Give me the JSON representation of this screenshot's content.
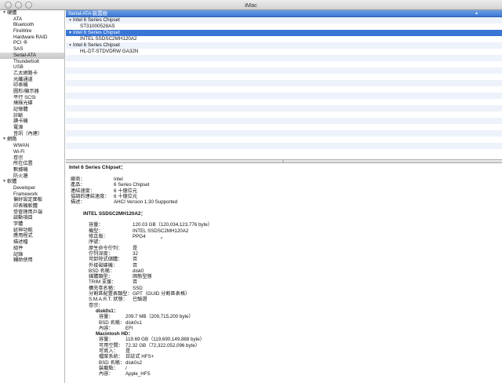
{
  "window": {
    "title": "iMac"
  },
  "sidebar": {
    "groups": [
      {
        "label": "硬體",
        "items": [
          "ATA",
          "Bluetooth",
          "FireWire",
          "Hardware RAID",
          "PCI 卡",
          "SAS",
          "Serial-ATA",
          "Thunderbolt",
          "USB",
          "乙太網路卡",
          "光纖通道",
          "印表機",
          "圖形/顯示器",
          "平行 SCSI",
          "燒錄光碟",
          "記憶體",
          "診斷",
          "讀卡機",
          "電源",
          "音訊（內建）"
        ]
      },
      {
        "label": "網路",
        "items": [
          "WWAN",
          "Wi-Fi",
          "卷宗",
          "所在位置",
          "數據機",
          "防火牆"
        ]
      },
      {
        "label": "軟體",
        "items": [
          "Developer",
          "Framework",
          "偏好設定面板",
          "印表機軟體",
          "受管理用戶端",
          "啟動項目",
          "字體",
          "延伸功能",
          "應用程式",
          "描述檔",
          "組件",
          "記錄",
          "輔助使用"
        ]
      }
    ],
    "selected": "Serial-ATA"
  },
  "tree": {
    "header": "Serial-ATA 裝置樹",
    "rows": [
      {
        "label": "Intel 6 Series Chipset",
        "level": 1,
        "expanded": true
      },
      {
        "label": "ST31000528AS",
        "level": 2
      },
      {
        "label": "Intel 6 Series Chipset",
        "level": 1,
        "expanded": true,
        "selected": true
      },
      {
        "label": "INTEL SSDSC2MH120A2",
        "level": 2
      },
      {
        "label": "Intel 6 Series Chipset",
        "level": 1,
        "expanded": true
      },
      {
        "label": "HL-DT-STDVDRW  GA32N",
        "level": 2
      }
    ]
  },
  "detail": {
    "title": "Intel 6 Series Chipset：",
    "controller": [
      {
        "k": "廠商：",
        "v": "Intel"
      },
      {
        "k": "產品：",
        "v": "6 Series Chipset"
      },
      {
        "k": "連結速度：",
        "v": "6 十億位元"
      },
      {
        "k": "協調的連結速度：",
        "v": "6 十億位元"
      },
      {
        "k": "描述：",
        "v": "AHCI Version 1.30 Supported"
      }
    ],
    "device_title": "INTEL SSDSC2MH120A2：",
    "device": [
      {
        "k": "容量：",
        "v": "120.03 GB（120,034,123,776 byte）"
      },
      {
        "k": "機型：",
        "v": "INTEL SSDSC2MH120A2"
      },
      {
        "k": "修正版：",
        "v": "PPG4"
      },
      {
        "k": "序號：",
        "v": ""
      },
      {
        "k": "原生命令佇列：",
        "v": "是"
      },
      {
        "k": "佇列深度：",
        "v": "32"
      },
      {
        "k": "可卸除式儲體：",
        "v": "否"
      },
      {
        "k": "外接磁碟機：",
        "v": "否"
      },
      {
        "k": "BSD 名稱：",
        "v": "disk0"
      },
      {
        "k": "媒體類型：",
        "v": "固態型態"
      },
      {
        "k": "TRIM 支援：",
        "v": "否"
      },
      {
        "k": "擴充卷名稱：",
        "v": "SSD"
      },
      {
        "k": "分割區配置表類型：",
        "v": "GPT（GUID 分割區表格）"
      },
      {
        "k": "S.M.A.R.T. 狀態：",
        "v": "已驗證"
      }
    ],
    "volumes_label": "卷宗：",
    "volumes": [
      {
        "name": "disk0s1：",
        "props": [
          {
            "k": "容量：",
            "v": "209.7 MB（209,715,200 byte）"
          },
          {
            "k": "BSD 名稱：",
            "v": "disk0s1"
          },
          {
            "k": "內容：",
            "v": "EFI"
          }
        ]
      },
      {
        "name": "Macintosh HD：",
        "props": [
          {
            "k": "容量：",
            "v": "119.69 GB（119,690,149,888 byte）"
          },
          {
            "k": "可用空間：",
            "v": "72.32 GB（72,322,052,096 byte）"
          },
          {
            "k": "可寫入：",
            "v": "是"
          },
          {
            "k": "檔案系統：",
            "v": "日誌式 HFS+"
          },
          {
            "k": "BSD 名稱：",
            "v": "disk0s2"
          },
          {
            "k": "裝載點：",
            "v": "/"
          },
          {
            "k": "內容：",
            "v": "Apple_HFS"
          }
        ]
      }
    ]
  }
}
